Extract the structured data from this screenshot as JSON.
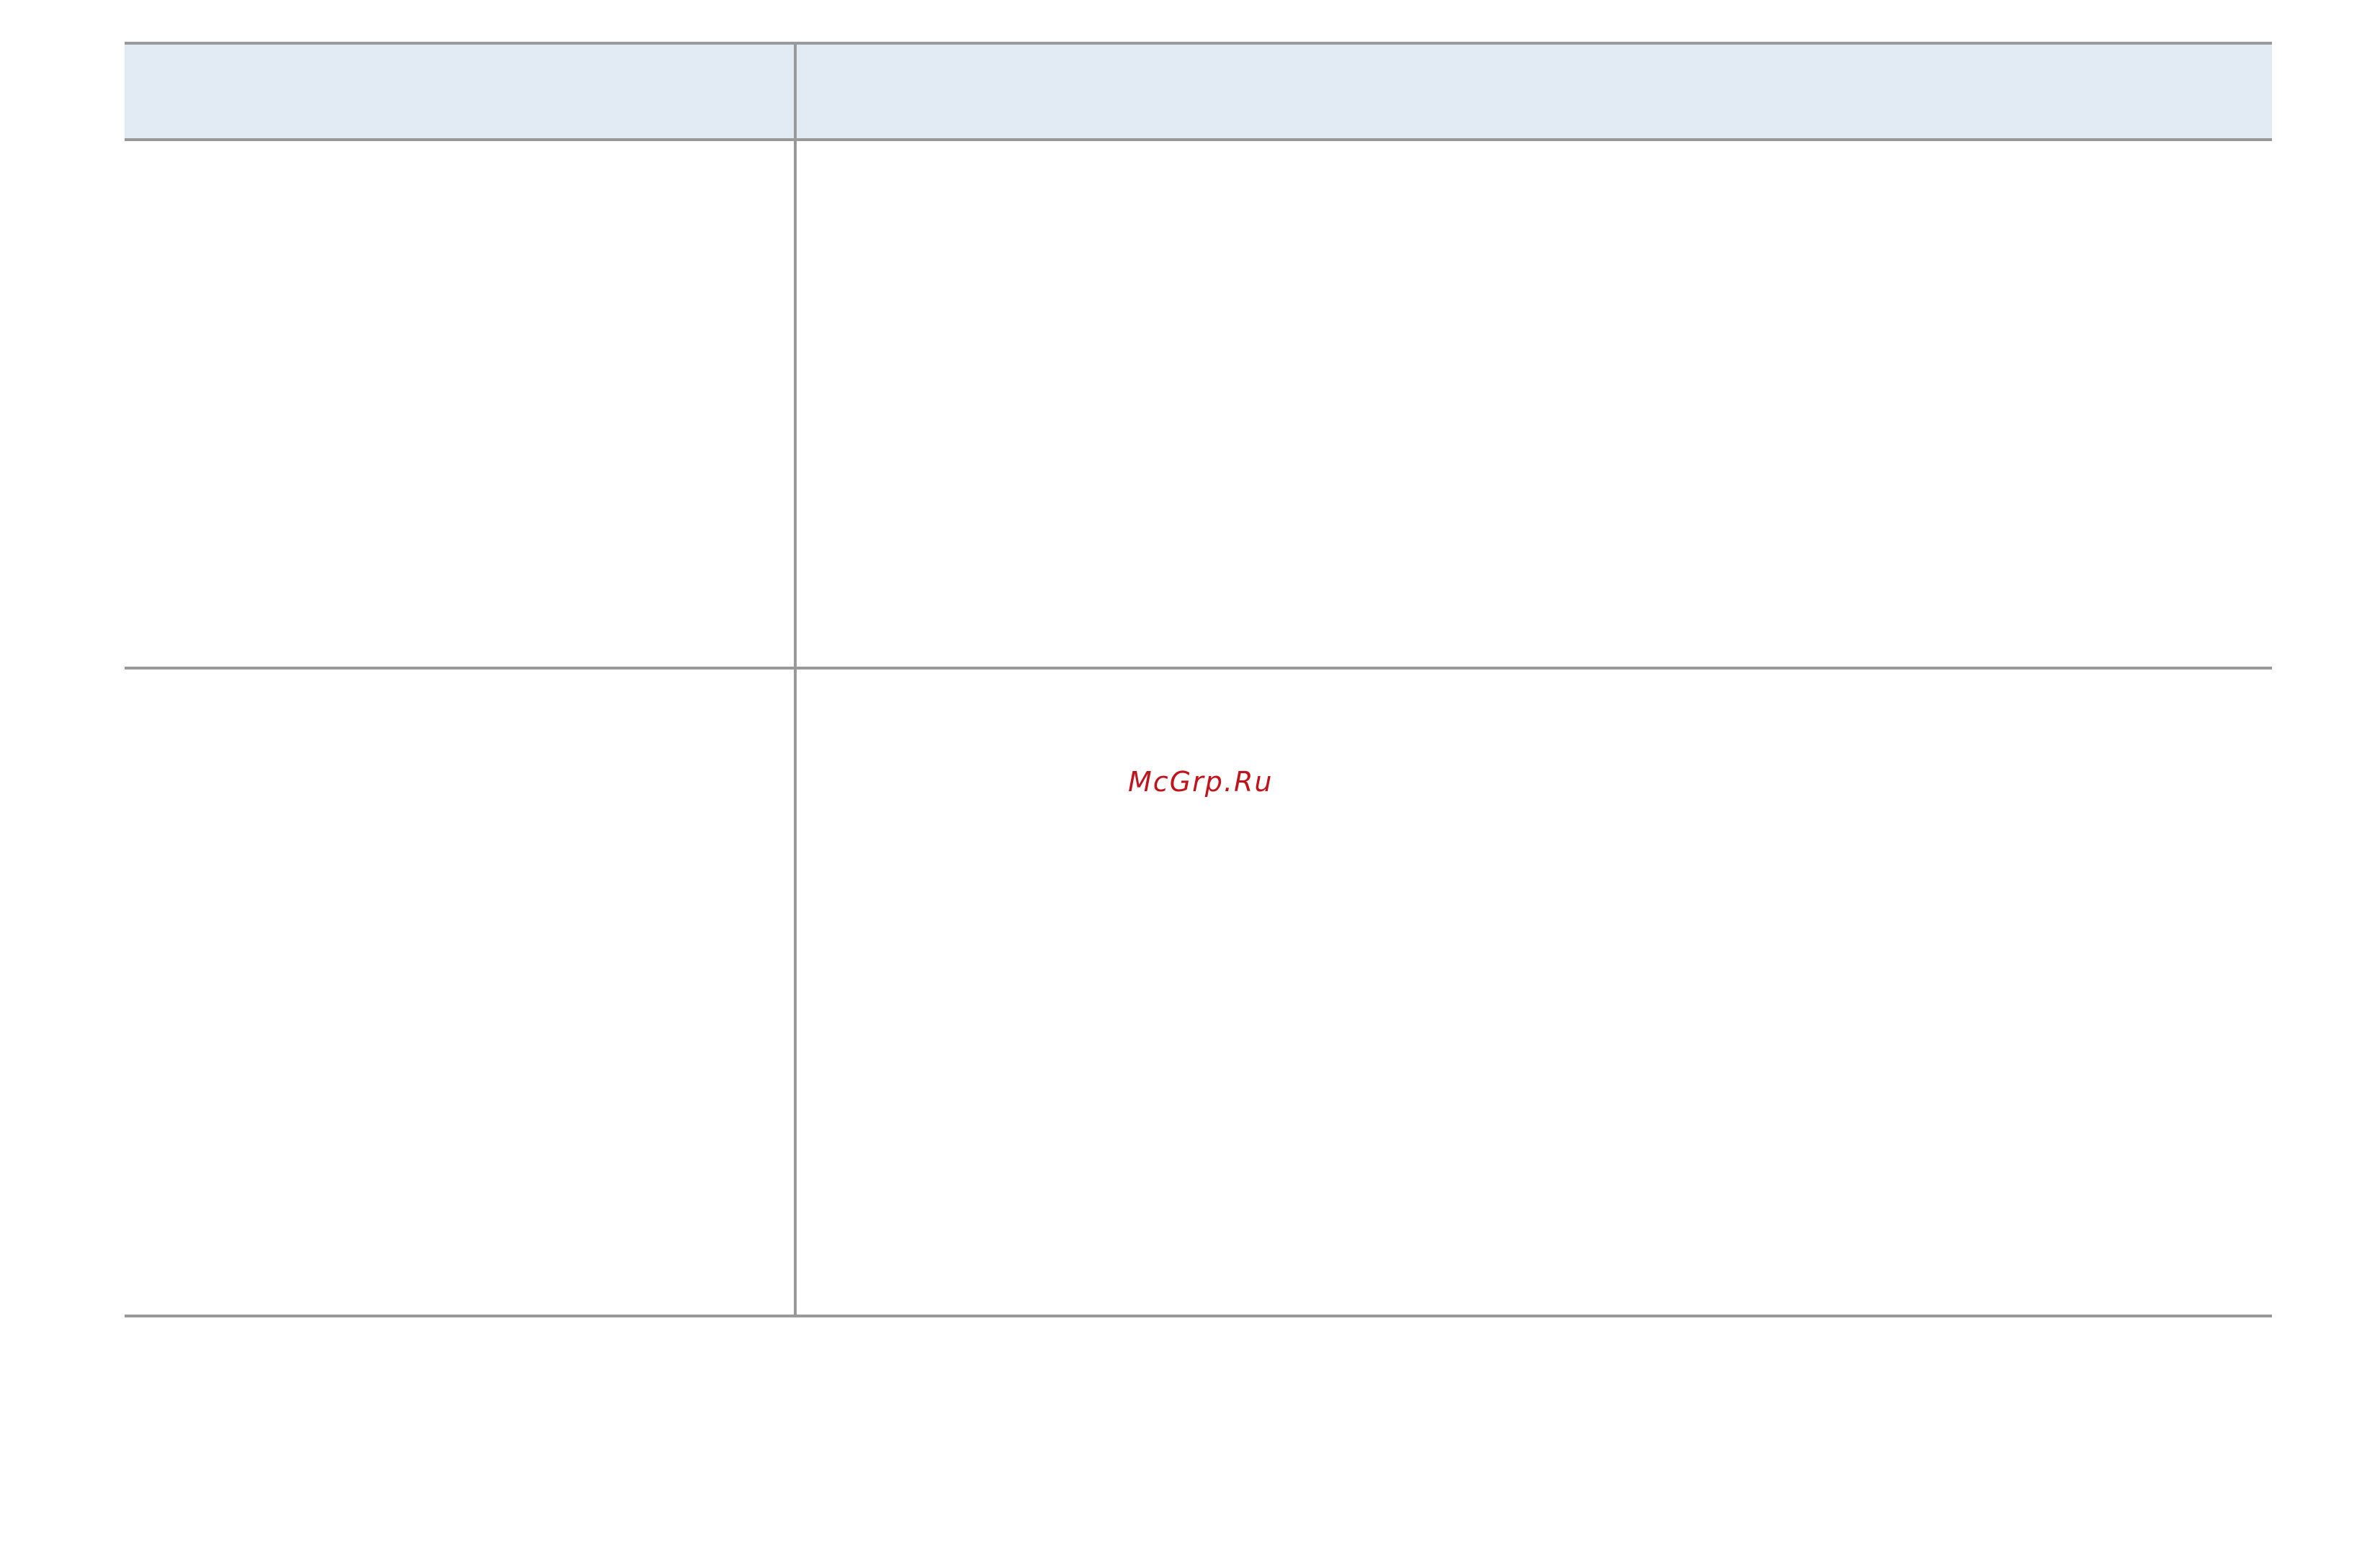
{
  "table": {
    "header": [
      "",
      ""
    ],
    "rows": [
      [
        "",
        ""
      ],
      [
        "",
        ""
      ]
    ]
  },
  "watermark": {
    "text": "McGrp.Ru",
    "color": "#c0141c"
  },
  "colors": {
    "header_background": "#e2ebf3",
    "rule": "#999999"
  }
}
